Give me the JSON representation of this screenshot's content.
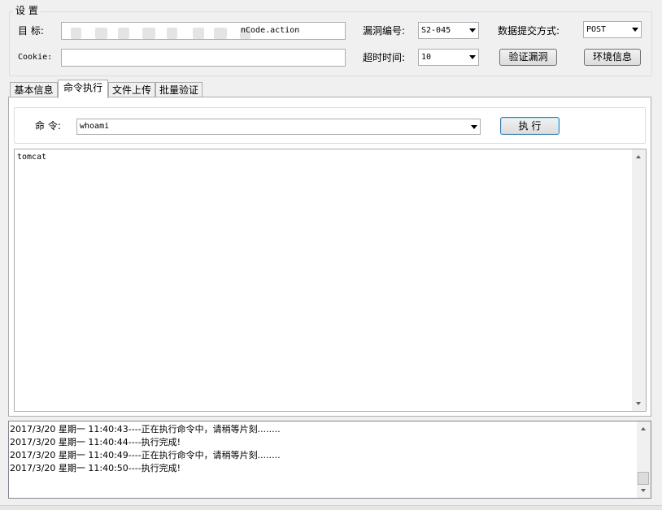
{
  "settings": {
    "group_title": "设 置",
    "target_label": "目  标:",
    "target_url_visible": "nCode.action",
    "vuln_label": "漏洞编号:",
    "vuln_value": "S2-045",
    "method_label": "数据提交方式:",
    "method_value": "POST",
    "cookie_label": "Cookie:",
    "cookie_value": "",
    "timeout_label": "超时时间:",
    "timeout_value": "10",
    "verify_button": "验证漏洞",
    "env_button": "环境信息"
  },
  "tabs": [
    {
      "label": "基本信息",
      "active": false
    },
    {
      "label": "命令执行",
      "active": true
    },
    {
      "label": "文件上传",
      "active": false
    },
    {
      "label": "批量验证",
      "active": false
    }
  ],
  "command": {
    "label": "命 令:",
    "value": "whoami",
    "execute_button": "执 行",
    "output": "tomcat"
  },
  "log": {
    "lines": [
      "2017/3/20 星期一 11:40:43----正在执行命令中，请稍等片刻........",
      "2017/3/20 星期一 11:40:44----执行完成!",
      "2017/3/20 星期一 11:40:49----正在执行命令中，请稍等片刻........",
      "2017/3/20 星期一 11:40:50----执行完成!"
    ]
  },
  "icons": {
    "dropdown": "chevron-down-icon",
    "scroll_up": "scroll-up-arrow-icon",
    "scroll_down": "scroll-down-arrow-icon"
  }
}
